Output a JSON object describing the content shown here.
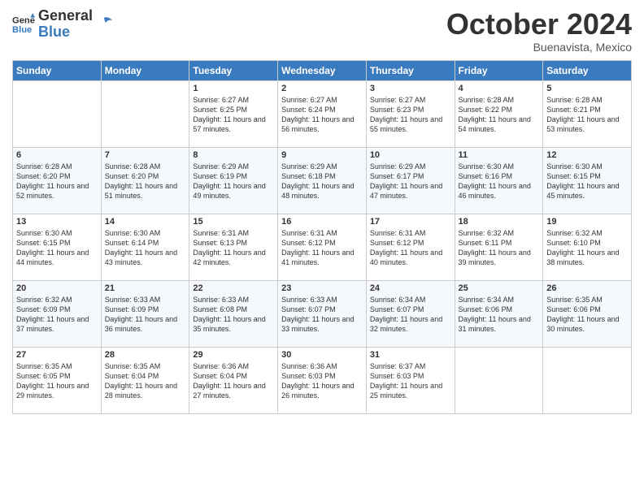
{
  "header": {
    "logo_line1": "General",
    "logo_line2": "Blue",
    "month": "October 2024",
    "location": "Buenavista, Mexico"
  },
  "days_of_week": [
    "Sunday",
    "Monday",
    "Tuesday",
    "Wednesday",
    "Thursday",
    "Friday",
    "Saturday"
  ],
  "weeks": [
    [
      {
        "day": "",
        "empty": true
      },
      {
        "day": "",
        "empty": true
      },
      {
        "day": "1",
        "sunrise": "6:27 AM",
        "sunset": "6:25 PM",
        "daylight": "11 hours and 57 minutes."
      },
      {
        "day": "2",
        "sunrise": "6:27 AM",
        "sunset": "6:24 PM",
        "daylight": "11 hours and 56 minutes."
      },
      {
        "day": "3",
        "sunrise": "6:27 AM",
        "sunset": "6:23 PM",
        "daylight": "11 hours and 55 minutes."
      },
      {
        "day": "4",
        "sunrise": "6:28 AM",
        "sunset": "6:22 PM",
        "daylight": "11 hours and 54 minutes."
      },
      {
        "day": "5",
        "sunrise": "6:28 AM",
        "sunset": "6:21 PM",
        "daylight": "11 hours and 53 minutes."
      }
    ],
    [
      {
        "day": "6",
        "sunrise": "6:28 AM",
        "sunset": "6:20 PM",
        "daylight": "11 hours and 52 minutes."
      },
      {
        "day": "7",
        "sunrise": "6:28 AM",
        "sunset": "6:20 PM",
        "daylight": "11 hours and 51 minutes."
      },
      {
        "day": "8",
        "sunrise": "6:29 AM",
        "sunset": "6:19 PM",
        "daylight": "11 hours and 49 minutes."
      },
      {
        "day": "9",
        "sunrise": "6:29 AM",
        "sunset": "6:18 PM",
        "daylight": "11 hours and 48 minutes."
      },
      {
        "day": "10",
        "sunrise": "6:29 AM",
        "sunset": "6:17 PM",
        "daylight": "11 hours and 47 minutes."
      },
      {
        "day": "11",
        "sunrise": "6:30 AM",
        "sunset": "6:16 PM",
        "daylight": "11 hours and 46 minutes."
      },
      {
        "day": "12",
        "sunrise": "6:30 AM",
        "sunset": "6:15 PM",
        "daylight": "11 hours and 45 minutes."
      }
    ],
    [
      {
        "day": "13",
        "sunrise": "6:30 AM",
        "sunset": "6:15 PM",
        "daylight": "11 hours and 44 minutes."
      },
      {
        "day": "14",
        "sunrise": "6:30 AM",
        "sunset": "6:14 PM",
        "daylight": "11 hours and 43 minutes."
      },
      {
        "day": "15",
        "sunrise": "6:31 AM",
        "sunset": "6:13 PM",
        "daylight": "11 hours and 42 minutes."
      },
      {
        "day": "16",
        "sunrise": "6:31 AM",
        "sunset": "6:12 PM",
        "daylight": "11 hours and 41 minutes."
      },
      {
        "day": "17",
        "sunrise": "6:31 AM",
        "sunset": "6:12 PM",
        "daylight": "11 hours and 40 minutes."
      },
      {
        "day": "18",
        "sunrise": "6:32 AM",
        "sunset": "6:11 PM",
        "daylight": "11 hours and 39 minutes."
      },
      {
        "day": "19",
        "sunrise": "6:32 AM",
        "sunset": "6:10 PM",
        "daylight": "11 hours and 38 minutes."
      }
    ],
    [
      {
        "day": "20",
        "sunrise": "6:32 AM",
        "sunset": "6:09 PM",
        "daylight": "11 hours and 37 minutes."
      },
      {
        "day": "21",
        "sunrise": "6:33 AM",
        "sunset": "6:09 PM",
        "daylight": "11 hours and 36 minutes."
      },
      {
        "day": "22",
        "sunrise": "6:33 AM",
        "sunset": "6:08 PM",
        "daylight": "11 hours and 35 minutes."
      },
      {
        "day": "23",
        "sunrise": "6:33 AM",
        "sunset": "6:07 PM",
        "daylight": "11 hours and 33 minutes."
      },
      {
        "day": "24",
        "sunrise": "6:34 AM",
        "sunset": "6:07 PM",
        "daylight": "11 hours and 32 minutes."
      },
      {
        "day": "25",
        "sunrise": "6:34 AM",
        "sunset": "6:06 PM",
        "daylight": "11 hours and 31 minutes."
      },
      {
        "day": "26",
        "sunrise": "6:35 AM",
        "sunset": "6:06 PM",
        "daylight": "11 hours and 30 minutes."
      }
    ],
    [
      {
        "day": "27",
        "sunrise": "6:35 AM",
        "sunset": "6:05 PM",
        "daylight": "11 hours and 29 minutes."
      },
      {
        "day": "28",
        "sunrise": "6:35 AM",
        "sunset": "6:04 PM",
        "daylight": "11 hours and 28 minutes."
      },
      {
        "day": "29",
        "sunrise": "6:36 AM",
        "sunset": "6:04 PM",
        "daylight": "11 hours and 27 minutes."
      },
      {
        "day": "30",
        "sunrise": "6:36 AM",
        "sunset": "6:03 PM",
        "daylight": "11 hours and 26 minutes."
      },
      {
        "day": "31",
        "sunrise": "6:37 AM",
        "sunset": "6:03 PM",
        "daylight": "11 hours and 25 minutes."
      },
      {
        "day": "",
        "empty": true
      },
      {
        "day": "",
        "empty": true
      }
    ]
  ]
}
